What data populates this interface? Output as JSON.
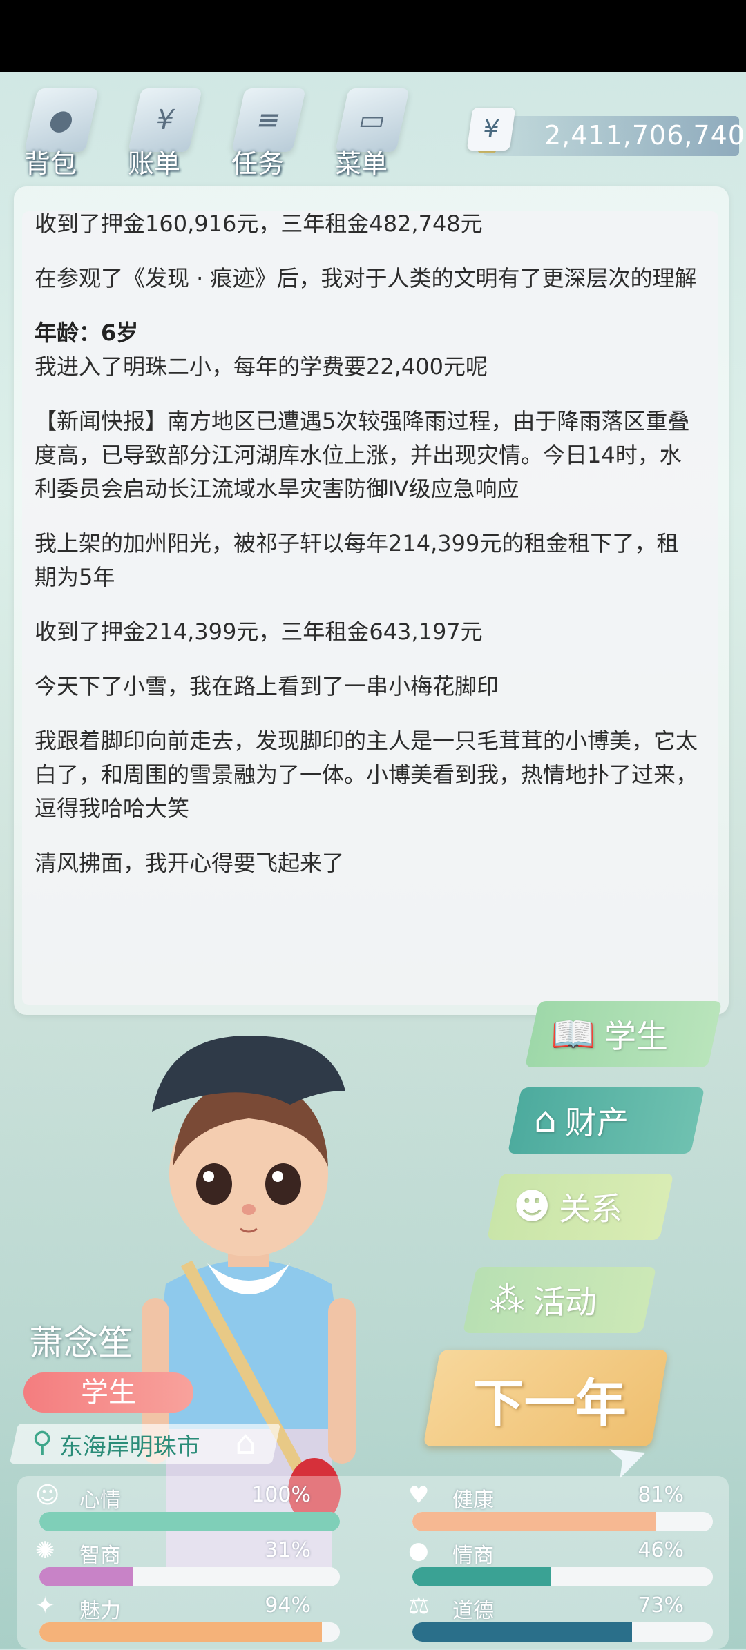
{
  "menu": [
    {
      "label": "背包",
      "icon": "backpack-icon"
    },
    {
      "label": "账单",
      "icon": "bill-icon"
    },
    {
      "label": "任务",
      "icon": "task-icon"
    },
    {
      "label": "菜单",
      "icon": "menu-icon"
    }
  ],
  "money": {
    "symbol": "¥",
    "amount": "2,411,706,740"
  },
  "log": [
    "收到了押金160,916元，三年租金482,748元",
    "在参观了《发现 · 痕迹》后，我对于人类的文明有了更深层次的理解",
    "我进入了明珠二小，每年的学费要22,400元呢",
    "【新闻快报】南方地区已遭遇5次较强降雨过程，由于降雨落区重叠度高，已导致部分江河湖库水位上涨，并出现灾情。今日14时，水利委员会启动长江流域水旱灾害防御Ⅳ级应急响应",
    "我上架的加州阳光，被祁子轩以每年214,399元的租金租下了，租期为5年",
    "收到了押金214,399元，三年租金643,197元",
    "今天下了小雪，我在路上看到了一串小梅花脚印",
    "我跟着脚印向前走去，发现脚印的主人是一只毛茸茸的小博美，它太白了，和周围的雪景融为了一体。小博美看到我，热情地扑了过来，逗得我哈哈大笑",
    "清风拂面，我开心得要飞起来了"
  ],
  "age_title": "年龄：6岁",
  "buttons": {
    "student": "学生",
    "asset": "财产",
    "relation": "关系",
    "activity": "活动",
    "next_year": "下一年"
  },
  "player": {
    "name": "萧念笙",
    "role": "学生",
    "location": "东海岸明珠市"
  },
  "stats": [
    {
      "name": "心情",
      "value": "100%",
      "fraction": 1.0,
      "color": "#7fcfb8",
      "icon": "smile-icon"
    },
    {
      "name": "健康",
      "value": "81%",
      "fraction": 0.81,
      "color": "#f6b892",
      "icon": "heart-icon"
    },
    {
      "name": "智商",
      "value": "31%",
      "fraction": 0.31,
      "color": "#c883c7",
      "icon": "bulb-icon"
    },
    {
      "name": "情商",
      "value": "46%",
      "fraction": 0.46,
      "color": "#3aa294",
      "icon": "apple-icon"
    },
    {
      "name": "魅力",
      "value": "94%",
      "fraction": 0.94,
      "color": "#f5b279",
      "icon": "sparkle-icon"
    },
    {
      "name": "道德",
      "value": "73%",
      "fraction": 0.73,
      "color": "#2a6f8a",
      "icon": "scale-icon"
    }
  ]
}
